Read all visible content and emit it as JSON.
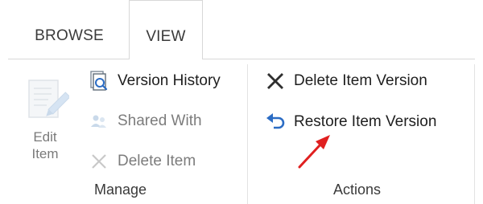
{
  "tabs": {
    "browse": "BROWSE",
    "view": "VIEW"
  },
  "manage": {
    "edit_item_line1": "Edit",
    "edit_item_line2": "Item",
    "version_history": "Version History",
    "shared_with": "Shared With",
    "delete_item": "Delete Item",
    "group_label": "Manage"
  },
  "actions": {
    "delete_item_version": "Delete Item Version",
    "restore_item_version": "Restore Item Version",
    "group_label": "Actions"
  },
  "icons": {
    "edit_item": "edit-document-icon",
    "version_history": "version-history-icon",
    "shared_with": "shared-with-icon",
    "delete_item": "delete-x-icon",
    "delete_item_version": "delete-x-icon",
    "restore_item_version": "restore-undo-arrow-icon",
    "annotation": "red-arrow-icon"
  },
  "colors": {
    "accent_blue": "#2b6cc4",
    "disabled_gray": "#7c7c7c",
    "annotation_red": "#e02020"
  }
}
